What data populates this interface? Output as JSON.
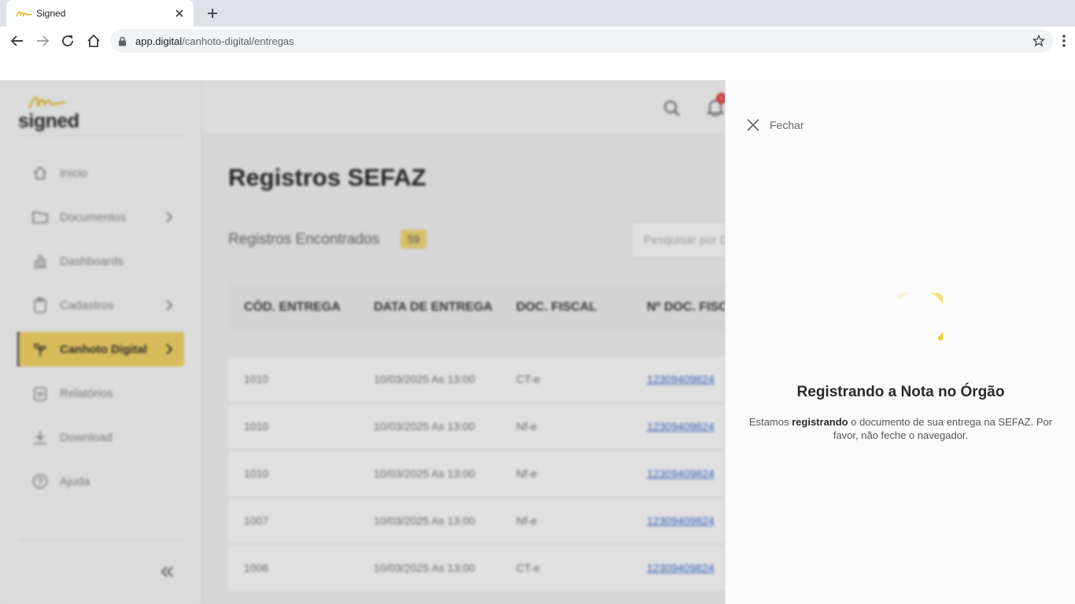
{
  "browser": {
    "tab_title": "Signed",
    "url_host": "app.digital",
    "url_path": "/canhoto-digital/entregas"
  },
  "sidebar": {
    "logo_text": "signed",
    "items": [
      {
        "label": "Inicio",
        "icon": "home-icon"
      },
      {
        "label": "Documentos",
        "icon": "folder-icon",
        "chevron": true
      },
      {
        "label": "Dashboards",
        "icon": "chart-icon"
      },
      {
        "label": "Cadastros",
        "icon": "clipboard-icon",
        "chevron": true
      },
      {
        "label": "Canhoto Digital",
        "icon": "plant-icon",
        "chevron": true,
        "active": true
      },
      {
        "label": "Relatórios",
        "icon": "report-icon"
      },
      {
        "label": "Download",
        "icon": "download-icon"
      },
      {
        "label": "Ajuda",
        "icon": "help-icon"
      }
    ]
  },
  "topbar": {
    "badge": "6"
  },
  "main": {
    "title": "Registros SEFAZ",
    "found_label": "Registros Encontrados",
    "found_count": "59",
    "search_placeholder": "Pesquisar por D",
    "columns": [
      "CÓD. ENTREGA",
      "DATA DE ENTREGA",
      "DOC. FISCAL",
      "Nº DOC. FISC"
    ],
    "rows": [
      {
        "code": "1010",
        "date": "10/03/2025 As 13:00",
        "doc": "CT-e",
        "number": "12309409824"
      },
      {
        "code": "1010",
        "date": "10/03/2025 As 13:00",
        "doc": "Nf-e",
        "number": "12309409824"
      },
      {
        "code": "1010",
        "date": "10/03/2025 As 13:00",
        "doc": "Nf-e",
        "number": "12309409824"
      },
      {
        "code": "1007",
        "date": "10/03/2025 As 13:00",
        "doc": "Nf-e",
        "number": "12309409824"
      },
      {
        "code": "1006",
        "date": "10/03/2025 As 13:00",
        "doc": "CT-e",
        "number": "12309409824"
      }
    ]
  },
  "panel": {
    "close_label": "Fechar",
    "title": "Registrando a Nota no Órgão",
    "message_pre": "Estamos ",
    "message_bold": "registrando",
    "message_post": " o documento de sua entrega na SEFAZ. Por favor, não feche o navegador."
  },
  "colors": {
    "accent": "#f6d768",
    "spinner": "#f5c518",
    "link": "#3b6fd1"
  }
}
